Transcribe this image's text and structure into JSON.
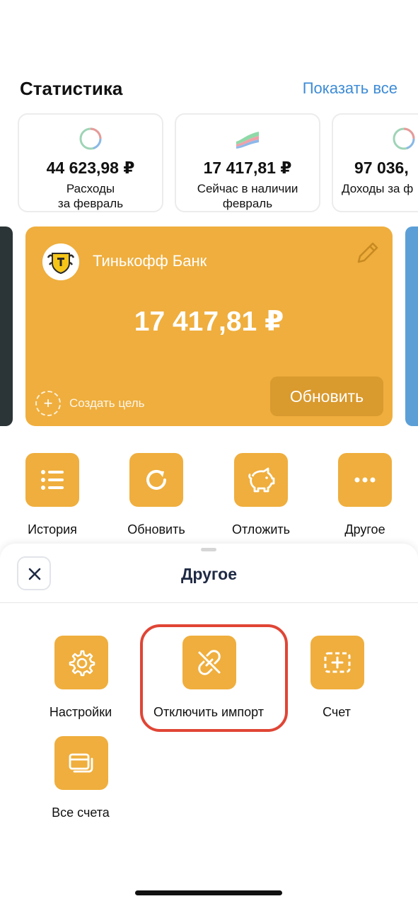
{
  "stats": {
    "title": "Статистика",
    "show_all": "Показать все",
    "cards": [
      {
        "value": "44 623,98 ₽",
        "label_line1": "Расходы",
        "label_line2": "за февраль"
      },
      {
        "value": "17 417,81 ₽",
        "label_line1": "Сейчас в наличии",
        "label_line2": "февраль"
      },
      {
        "value": "97 036,",
        "label_line1": "Доходы за ф",
        "label_line2": ""
      }
    ]
  },
  "bank_card": {
    "bank_name": "Тинькофф Банк",
    "balance": "17 417,81 ₽",
    "goal_plus": "+",
    "create_goal": "Создать цель",
    "refresh": "Обновить",
    "color": "#efae3d"
  },
  "actions": [
    {
      "label": "История",
      "icon": "list-icon"
    },
    {
      "label": "Обновить",
      "icon": "refresh-icon"
    },
    {
      "label": "Отложить",
      "icon": "piggy-bank-icon"
    },
    {
      "label": "Другое",
      "icon": "more-icon"
    }
  ],
  "sheet": {
    "title": "Другое",
    "options": [
      {
        "label": "Настройки",
        "icon": "gear-icon"
      },
      {
        "label": "Отключить импорт",
        "icon": "unlink-icon"
      },
      {
        "label": "Счет",
        "icon": "add-account-icon"
      },
      {
        "label": "Все счета",
        "icon": "cards-icon"
      }
    ]
  },
  "colors": {
    "accent": "#efae3d",
    "link": "#3d8bd6",
    "highlight": "#e04535"
  }
}
